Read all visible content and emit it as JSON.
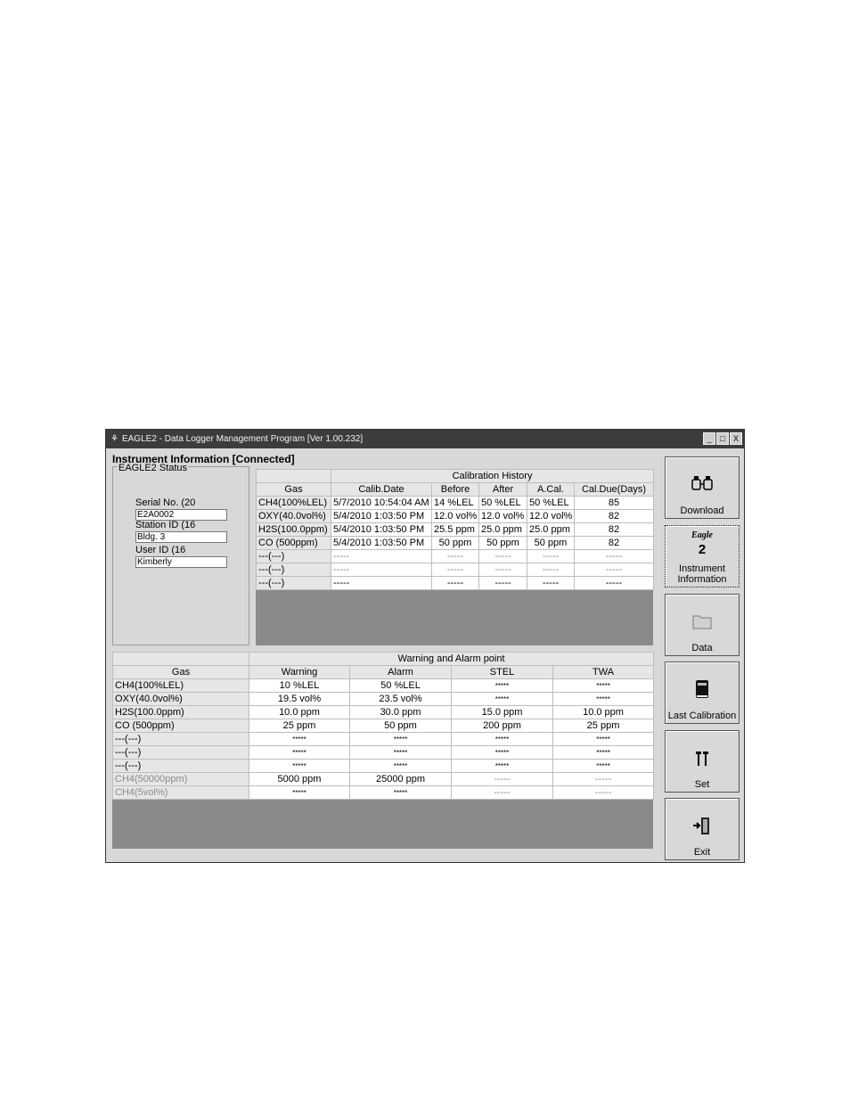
{
  "window": {
    "title": "EAGLE2  - Data Logger Management Program [Ver 1.00.232]",
    "controls": [
      "_",
      "□",
      "X"
    ]
  },
  "section_title": "Instrument Information [Connected]",
  "status": {
    "legend": "EAGLE2  Status",
    "serial_label": "Serial No. (20",
    "serial_value": "E2A0002",
    "station_label": "Station ID (16",
    "station_value": "Bldg. 3",
    "user_label": "User ID (16",
    "user_value": "Kimberly"
  },
  "calibration": {
    "group_header": "Calibration History",
    "columns": [
      "Gas",
      "Calib.Date",
      "Before",
      "After",
      "A.Cal.",
      "Cal.Due(Days)"
    ],
    "rows": [
      [
        "CH4(100%LEL)",
        "5/7/2010 10:54:04 AM",
        "14 %LEL",
        "50 %LEL",
        "50 %LEL",
        "85"
      ],
      [
        "OXY(40.0vol%)",
        "5/4/2010 1:03:50 PM",
        "12.0 vol%",
        "12.0 vol%",
        "12.0 vol%",
        "82"
      ],
      [
        "H2S(100.0ppm)",
        "5/4/2010 1:03:50 PM",
        "25.5 ppm",
        "25.0 ppm",
        "25.0 ppm",
        "82"
      ],
      [
        "CO (500ppm)",
        "5/4/2010 1:03:50 PM",
        "50 ppm",
        "50 ppm",
        "50 ppm",
        "82"
      ],
      [
        "---(---)",
        "-----",
        "-----",
        "-----",
        "-----",
        "-----"
      ],
      [
        "---(---)",
        "-----",
        "-----",
        "-----",
        "-----",
        "-----"
      ],
      [
        "---(---)",
        "-----",
        "-----",
        "-----",
        "-----",
        "-----"
      ]
    ]
  },
  "alarm": {
    "group_header": "Warning and Alarm point",
    "columns": [
      "Gas",
      "Warning",
      "Alarm",
      "STEL",
      "TWA"
    ],
    "rows": [
      [
        "CH4(100%LEL)",
        "10 %LEL",
        "50 %LEL",
        "*****",
        "*****"
      ],
      [
        "OXY(40.0vol%)",
        "19.5 vol%",
        "23.5 vol%",
        "*****",
        "*****"
      ],
      [
        "H2S(100.0ppm)",
        "10.0 ppm",
        "30.0 ppm",
        "15.0 ppm",
        "10.0 ppm"
      ],
      [
        "CO (500ppm)",
        "25 ppm",
        "50 ppm",
        "200 ppm",
        "25 ppm"
      ],
      [
        "---(---)",
        "*****",
        "*****",
        "*****",
        "*****"
      ],
      [
        "---(---)",
        "*****",
        "*****",
        "*****",
        "*****"
      ],
      [
        "---(---)",
        "*****",
        "*****",
        "*****",
        "*****"
      ],
      [
        "CH4(50000ppm)",
        "5000 ppm",
        "25000 ppm",
        "-----",
        "-----"
      ],
      [
        "CH4(5vol%)",
        "*****",
        "*****",
        "-----",
        "-----"
      ]
    ]
  },
  "sidebar": {
    "download": "Download",
    "instrument_logo": "Eagle",
    "instrument_logo_num": "2",
    "instrument_line1": "Instrument",
    "instrument_line2": "Information",
    "data": "Data",
    "last_calibration": "Last Calibration",
    "set": "Set",
    "exit": "Exit"
  }
}
